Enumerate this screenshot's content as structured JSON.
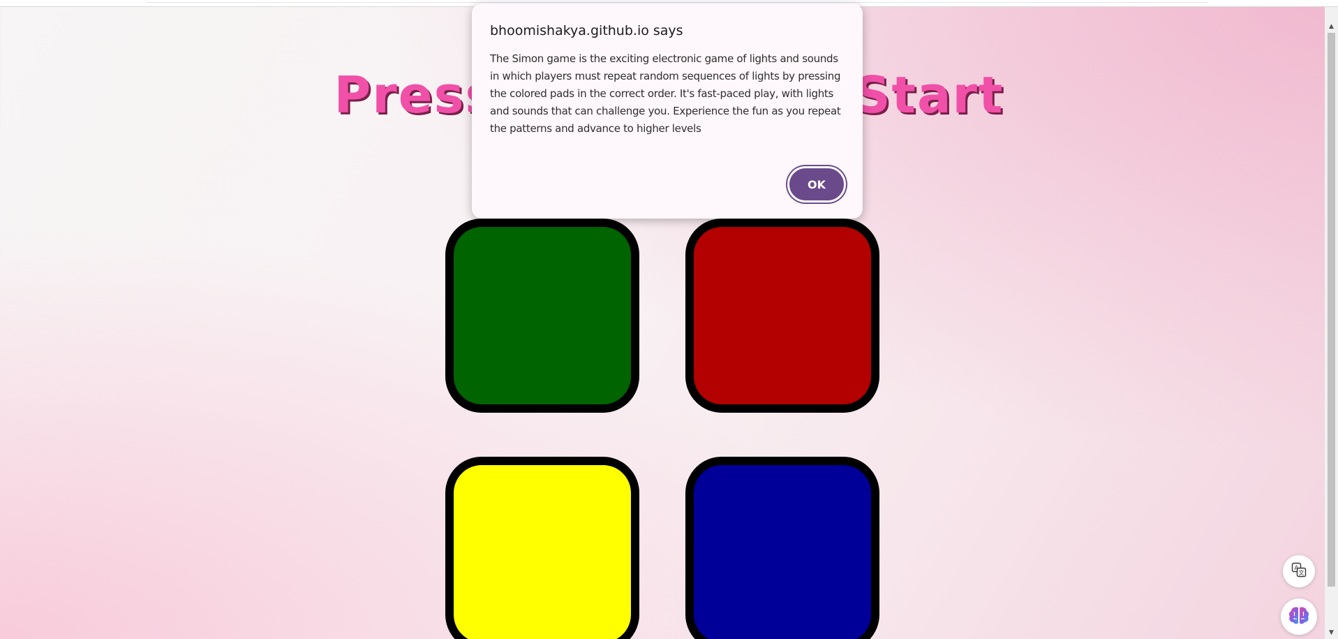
{
  "page": {
    "title": "Press Any Key to Start"
  },
  "pads": [
    {
      "color_name": "green",
      "color": "#006400"
    },
    {
      "color_name": "red",
      "color": "#b30000"
    },
    {
      "color_name": "yellow",
      "color": "#ffff00"
    },
    {
      "color_name": "blue",
      "color": "#000099"
    }
  ],
  "dialog": {
    "title": "bhoomishakya.github.io says",
    "message": "The Simon game is the exciting electronic game of lights and sounds in which players must repeat random sequences of lights by pressing the colored pads in the correct order. It's fast-paced play, with lights and sounds that can challenge you. Experience the fun as you repeat the patterns and advance to higher levels",
    "ok_label": "OK"
  },
  "floating_buttons": {
    "translate_icon": "translate-icon",
    "brain_icon": "brain-icon"
  },
  "colors": {
    "title_pink": "#f050a8",
    "dialog_button": "#6a4a8a"
  }
}
